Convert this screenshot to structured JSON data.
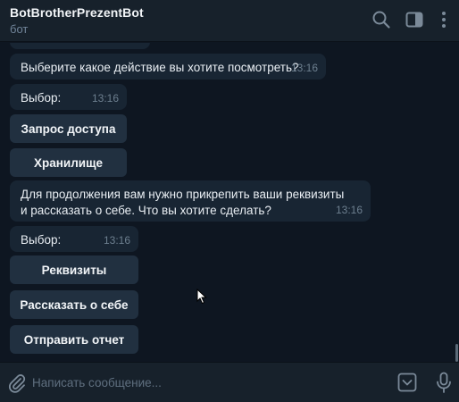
{
  "header": {
    "title": "BotBrotherPrezentBot",
    "subtitle": "бот"
  },
  "messages": [
    {
      "text": "Выберите какое действие вы хотите посмотреть?",
      "time": "13:16"
    },
    {
      "text": "Выбор:",
      "time": "13:16"
    },
    {
      "text": "Для продолжения вам нужно прикрепить ваши реквизиты и рассказать о себе. Что вы хотите сделать?",
      "time": "13:16"
    },
    {
      "text": "Выбор:",
      "time": "13:16"
    }
  ],
  "keyboards": {
    "first": [
      "Запрос доступа",
      "Хранилище"
    ],
    "second": [
      "Реквизиты",
      "Рассказать о себе",
      "Отправить отчет"
    ]
  },
  "composer": {
    "placeholder": "Написать сообщение..."
  },
  "colors": {
    "background": "#0e1621",
    "header": "#17212b",
    "bubble": "#182533",
    "keyboard_button": "#213040"
  }
}
